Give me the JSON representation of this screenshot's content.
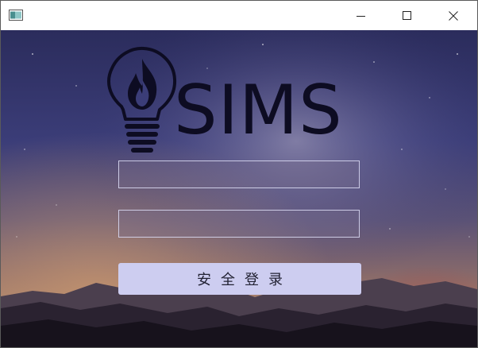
{
  "window": {
    "app_icon": "window-app-icon",
    "controls": {
      "minimize_icon": "minimize-icon",
      "maximize_icon": "maximize-icon",
      "close_icon": "close-icon"
    }
  },
  "logo": {
    "icon": "flame-lightbulb-icon",
    "text": "SIMS"
  },
  "form": {
    "username": {
      "value": "",
      "placeholder": ""
    },
    "password": {
      "value": "",
      "placeholder": ""
    },
    "login_label": "安全登录"
  },
  "colors": {
    "logo": "#0d0c22",
    "button_bg": "#cdcdf0",
    "field_border": "#d7d7f0"
  }
}
